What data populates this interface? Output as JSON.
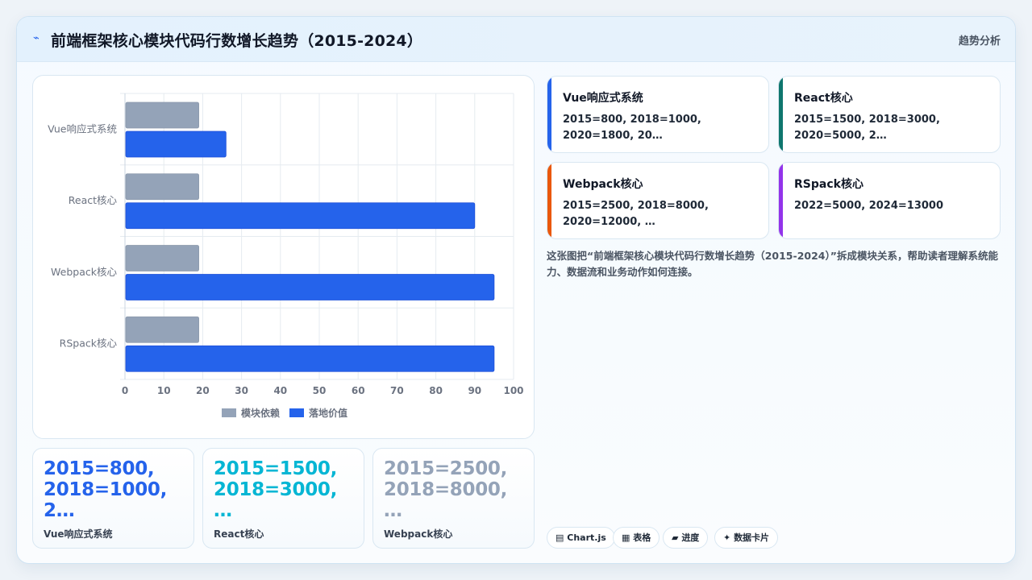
{
  "header": {
    "title": "前端框架核心模块代码行数增长趋势（2015-2024）",
    "tag": "趋势分析"
  },
  "chart_data": {
    "type": "bar",
    "orientation": "horizontal",
    "categories": [
      "Vue响应式系统",
      "React核心",
      "Webpack核心",
      "RSpack核心"
    ],
    "series": [
      {
        "name": "模块依赖",
        "values": [
          19,
          19,
          19,
          19
        ],
        "color": "#94a3b8"
      },
      {
        "name": "落地价值",
        "values": [
          26,
          90,
          95,
          95
        ],
        "color": "#2563eb"
      }
    ],
    "xlim": [
      0,
      100
    ],
    "xticks": [
      0,
      10,
      20,
      30,
      40,
      50,
      60,
      70,
      80,
      90,
      100
    ],
    "grid": true,
    "legend": "bottom"
  },
  "kpis": [
    {
      "value": "2015=800, 2018=1000, 2…",
      "label": "Vue响应式系统",
      "color": "#2563eb"
    },
    {
      "value": "2015=1500, 2018=3000, …",
      "label": "React核心",
      "color": "#06b6d4"
    },
    {
      "value": "2015=2500, 2018=8000, …",
      "label": "Webpack核心",
      "color": "#94a3b8"
    }
  ],
  "cards": [
    {
      "name": "Vue响应式系统",
      "desc": "2015=800, 2018=1000, 2020=1800, 20…",
      "color": "#2563eb"
    },
    {
      "name": "React核心",
      "desc": "2015=1500, 2018=3000, 2020=5000, 2…",
      "color": "#0f766e"
    },
    {
      "name": "Webpack核心",
      "desc": "2015=2500, 2018=8000, 2020=12000, …",
      "color": "#ea580c"
    },
    {
      "name": "RSpack核心",
      "desc": "2022=5000, 2024=13000",
      "color": "#9333ea"
    }
  ],
  "note": "这张图把“前端框架核心模块代码行数增长趋势（2015-2024）”拆成模块关系，帮助读者理解系统能力、数据流和业务动作如何连接。",
  "chips": [
    {
      "icon": "▤",
      "label": "Chart.js"
    },
    {
      "icon": "▦",
      "label": "表格"
    },
    {
      "icon": "▰",
      "label": "进度"
    },
    {
      "icon": "✦",
      "label": "数据卡片"
    }
  ]
}
